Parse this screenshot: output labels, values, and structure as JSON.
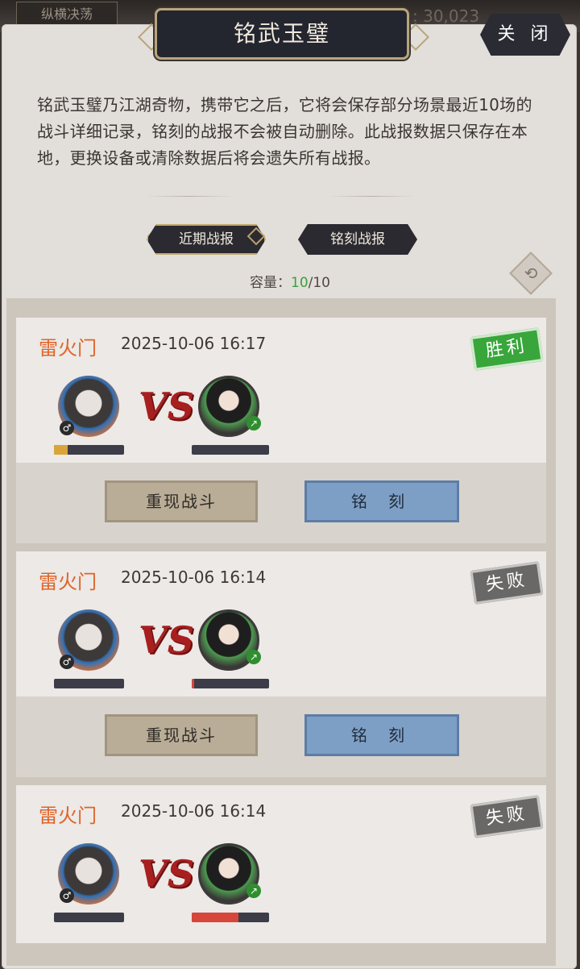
{
  "top": {
    "left_tab": "纵横决荡",
    "right_value": ": 30,023"
  },
  "window": {
    "title": "铭武玉璧",
    "close_label": "关 闭"
  },
  "description": "铭武玉璧乃江湖奇物，携带它之后，它将会保存部分场景最近10场的战斗详细记录，铭刻的战报不会被自动删除。此战报数据只保存在本地，更换设备或清除数据后将会遗失所有战报。",
  "tabs": {
    "recent": "近期战报",
    "engraved": "铭刻战报"
  },
  "capacity": {
    "label": "容量：",
    "used": "10",
    "total": "/10"
  },
  "labels": {
    "replay": "重现战斗",
    "engrave": "铭 刻",
    "vs": "VS"
  },
  "reports": [
    {
      "sect": "雷火门",
      "time": "2025-10-06 16:17",
      "result": "胜利",
      "left_hp": 0.2,
      "right_hp": 0.0
    },
    {
      "sect": "雷火门",
      "time": "2025-10-06 16:14",
      "result": "失败",
      "left_hp": 0.0,
      "right_hp": 0.03
    },
    {
      "sect": "雷火门",
      "time": "2025-10-06 16:14",
      "result": "失败",
      "left_hp": 0.0,
      "right_hp": 0.6
    }
  ],
  "colors": {
    "win": "#38a63a",
    "lose": "#6a6866",
    "sect": "#e0632a"
  }
}
